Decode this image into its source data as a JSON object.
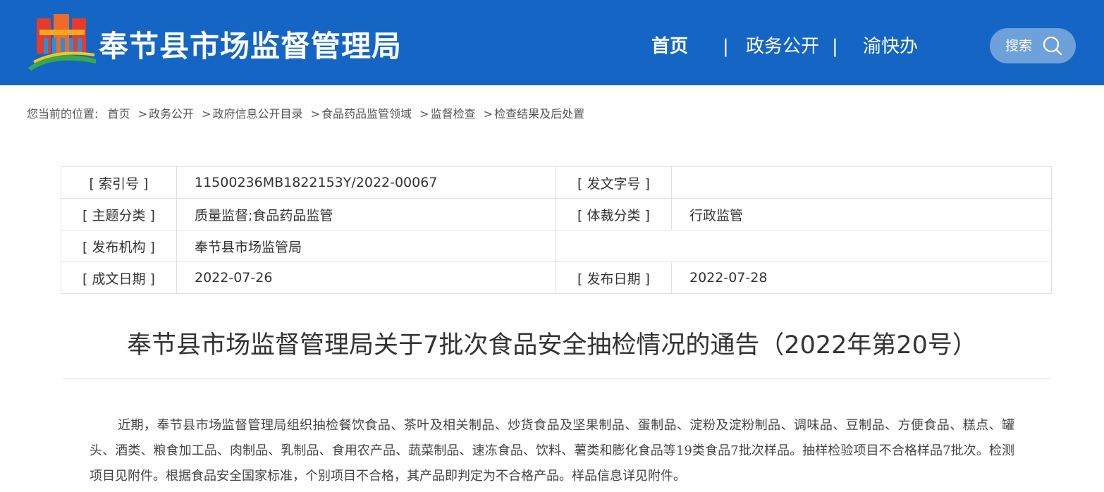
{
  "header": {
    "site_title": "奉节县市场监督管理局",
    "nav": [
      {
        "label": "首页",
        "active": true
      },
      {
        "label": "政务公开",
        "active": false
      },
      {
        "label": "渝快办",
        "active": false
      }
    ],
    "nav_separator": "|",
    "search_label": "搜索",
    "colors": {
      "header_bg": "#1566c4",
      "logo_red": "#e83a2a",
      "logo_orange": "#f5a623",
      "logo_blue": "#2a8fd8",
      "logo_green": "#3aa84a"
    }
  },
  "breadcrumb": {
    "prefix": "您当前的位置:",
    "items": [
      "首页",
      "政务公开",
      "政府信息公开目录",
      "食品药品监管领域",
      "监督检查",
      "检查结果及后处置"
    ],
    "separator": ">"
  },
  "meta": {
    "index_no_label": "[ 索引号 ]",
    "index_no": "11500236MB1822153Y/2022-00067",
    "doc_no_label": "[ 发文字号 ]",
    "doc_no": "",
    "topic_label": "[ 主题分类 ]",
    "topic": "质量监督;食品药品监管",
    "genre_label": "[ 体裁分类 ]",
    "genre": "行政监管",
    "publisher_label": "[ 发布机构 ]",
    "publisher": "奉节县市场监管局",
    "created_label": "[ 成文日期 ]",
    "created": "2022-07-26",
    "published_label": "[ 发布日期 ]",
    "published": "2022-07-28"
  },
  "article": {
    "title": "奉节县市场监督管理局关于7批次食品安全抽检情况的通告（2022年第20号）",
    "paragraph": "近期，奉节县市场监督管理局组织抽检餐饮食品、茶叶及相关制品、炒货食品及坚果制品、蛋制品、淀粉及淀粉制品、调味品、豆制品、方便食品、糕点、罐头、酒类、粮食加工品、肉制品、乳制品、食用农产品、蔬菜制品、速冻食品、饮料、薯类和膨化食品等19类食品7批次样品。抽样检验项目不合格样品7批次。检测项目见附件。根据食品安全国家标准，个别项目不合格，其产品即判定为不合格产品。样品信息详见附件。"
  }
}
